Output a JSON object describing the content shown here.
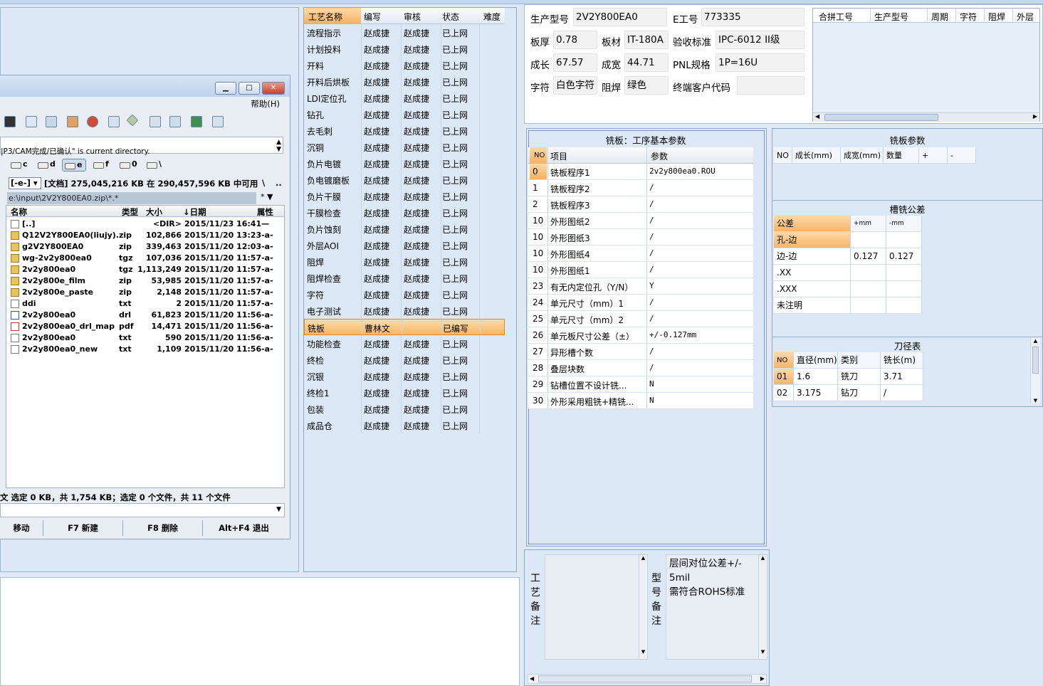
{
  "tc": {
    "menu_help": "帮助(H)",
    "current_dir_text": "|P3/CAM完成/已确认\" is current directory.",
    "drives": [
      "c",
      "d",
      "e",
      "f",
      "0",
      "\\"
    ],
    "drive_select": "[-e-]",
    "info": "[文档]  275,045,216 KB 在 290,457,596 KB 中可用",
    "path": "e:\\input\\2V2Y800EA0.zip\\*.*",
    "path_right": "* ▼",
    "columns": {
      "name": "名称",
      "type": "类型",
      "size": "大小",
      "date": "↓日期",
      "attr": "属性"
    },
    "files": [
      {
        "icon": "up-dir-icon",
        "name": "[..]",
        "type": "",
        "size": "<DIR>",
        "date": "2015/11/23 16:41—"
      },
      {
        "icon": "zip-file-icon",
        "name": "Q12V2Y800EA0(liujy)..",
        "type": "zip",
        "size": "102,866",
        "date": "2015/11/20 13:23-a-"
      },
      {
        "icon": "zip-file-icon",
        "name": "g2V2Y800EA0",
        "type": "zip",
        "size": "339,463",
        "date": "2015/11/20 12:03-a-"
      },
      {
        "icon": "zip-file-icon",
        "name": "wg-2v2y800ea0",
        "type": "tgz",
        "size": "107,036",
        "date": "2015/11/20 11:57-a-"
      },
      {
        "icon": "zip-file-icon",
        "name": "2v2y800ea0",
        "type": "tgz",
        "size": "1,113,249",
        "date": "2015/11/20 11:57-a-"
      },
      {
        "icon": "zip-file-icon",
        "name": "2v2y800e_film",
        "type": "zip",
        "size": "53,985",
        "date": "2015/11/20 11:57-a-"
      },
      {
        "icon": "zip-file-icon",
        "name": "2v2y800e_paste",
        "type": "zip",
        "size": "2,148",
        "date": "2015/11/20 11:57-a-"
      },
      {
        "icon": "text-file-icon",
        "name": "ddi",
        "type": "txt",
        "size": "2",
        "date": "2015/11/20 11:57-a-"
      },
      {
        "icon": "drill-file-icon",
        "name": "2v2y800ea0",
        "type": "drl",
        "size": "61,823",
        "date": "2015/11/20 11:56-a-"
      },
      {
        "icon": "pdf-file-icon",
        "name": "2v2y800ea0_drl_map",
        "type": "pdf",
        "size": "14,471",
        "date": "2015/11/20 11:56-a-"
      },
      {
        "icon": "text-file-icon",
        "name": "2v2y800ea0",
        "type": "txt",
        "size": "590",
        "date": "2015/11/20 11:56-a-"
      },
      {
        "icon": "text-file-icon",
        "name": "2v2y800ea0_new",
        "type": "txt",
        "size": "1,109",
        "date": "2015/11/20 11:56-a-"
      }
    ],
    "status": "文  选定 0 KB，共 1,754 KB；选定 0 个文件，共 11 个文件",
    "fkeys": [
      "移动",
      "F7 新建",
      "F8 删除",
      "Alt+F4 退出"
    ]
  },
  "process": {
    "headers": [
      "工艺名称",
      "编写",
      "审核",
      "状态",
      "难度"
    ],
    "rows": [
      [
        "流程指示",
        "赵成捷",
        "赵成捷",
        "已上网"
      ],
      [
        "计划投料",
        "赵成捷",
        "赵成捷",
        "已上网"
      ],
      [
        "开料",
        "赵成捷",
        "赵成捷",
        "已上网"
      ],
      [
        "开料后烘板",
        "赵成捷",
        "赵成捷",
        "已上网"
      ],
      [
        "LDI定位孔",
        "赵成捷",
        "赵成捷",
        "已上网"
      ],
      [
        "钻孔",
        "赵成捷",
        "赵成捷",
        "已上网"
      ],
      [
        "去毛刺",
        "赵成捷",
        "赵成捷",
        "已上网"
      ],
      [
        "沉铜",
        "赵成捷",
        "赵成捷",
        "已上网"
      ],
      [
        "负片电镀",
        "赵成捷",
        "赵成捷",
        "已上网"
      ],
      [
        "负电镀磨板",
        "赵成捷",
        "赵成捷",
        "已上网"
      ],
      [
        "负片干膜",
        "赵成捷",
        "赵成捷",
        "已上网"
      ],
      [
        "干膜检查",
        "赵成捷",
        "赵成捷",
        "已上网"
      ],
      [
        "负片蚀刻",
        "赵成捷",
        "赵成捷",
        "已上网"
      ],
      [
        "外层AOI",
        "赵成捷",
        "赵成捷",
        "已上网"
      ],
      [
        "阻焊",
        "赵成捷",
        "赵成捷",
        "已上网"
      ],
      [
        "阻焊检查",
        "赵成捷",
        "赵成捷",
        "已上网"
      ],
      [
        "字符",
        "赵成捷",
        "赵成捷",
        "已上网"
      ],
      [
        "电子测试",
        "赵成捷",
        "赵成捷",
        "已上网"
      ],
      [
        "铣板",
        "曹林文",
        "",
        "已编写"
      ],
      [
        "功能检查",
        "赵成捷",
        "赵成捷",
        "已上网"
      ],
      [
        "终检",
        "赵成捷",
        "赵成捷",
        "已上网"
      ],
      [
        "沉银",
        "赵成捷",
        "赵成捷",
        "已上网"
      ],
      [
        "终检1",
        "赵成捷",
        "赵成捷",
        "已上网"
      ],
      [
        "包装",
        "赵成捷",
        "赵成捷",
        "已上网"
      ],
      [
        "成品仓",
        "赵成捷",
        "赵成捷",
        "已上网"
      ]
    ]
  },
  "info": {
    "model_label": "生产型号",
    "model": "2V2Y800EA0",
    "eno_label": "E工号",
    "eno": "773335",
    "thick_label": "板厚",
    "thick": "0.78",
    "mat_label": "板材",
    "mat": "IT-180A",
    "std_label": "验收标准",
    "std": "IPC-6012 II级",
    "len_label": "成长",
    "len": "67.57",
    "wid_label": "成宽",
    "wid": "44.71",
    "pnl_label": "PNL规格",
    "pnl": "1P=16U",
    "char_label": "字符",
    "char": "白色字符",
    "mask_label": "阻焊",
    "mask": "绿色",
    "cust_label": "终端客户代码",
    "cust": "",
    "combo_headers": [
      "合拼工号",
      "生产型号",
      "周期",
      "字符",
      "阻焊",
      "外层"
    ]
  },
  "mill": {
    "title": "铣板：工序基本参数",
    "headers": [
      "NO",
      "项目",
      "参数"
    ],
    "rows": [
      [
        "0",
        "铣板程序1",
        "2v2y800ea0.ROU"
      ],
      [
        "1",
        "铣板程序2",
        "/"
      ],
      [
        "2",
        "铣板程序3",
        "/"
      ],
      [
        "10",
        "外形图纸2",
        "/"
      ],
      [
        "10",
        "外形图纸3",
        "/"
      ],
      [
        "10",
        "外形图纸4",
        "/"
      ],
      [
        "10",
        "外形图纸1",
        "/"
      ],
      [
        "23",
        "有无内定位孔（Y/N）",
        "Y"
      ],
      [
        "24",
        "单元尺寸（mm）1",
        "/"
      ],
      [
        "25",
        "单元尺寸（mm）2",
        "/"
      ],
      [
        "26",
        "单元板尺寸公差（±）",
        "+/-0.127mm"
      ],
      [
        "27",
        "异形槽个数",
        "/"
      ],
      [
        "28",
        "叠层块数",
        "/"
      ],
      [
        "29",
        "钻槽位置不设计铣...",
        "N"
      ],
      [
        "30",
        "外形采用粗铣+精铣...",
        "N"
      ]
    ]
  },
  "notes": {
    "craft_label": "工艺备注",
    "craft_text": "",
    "model_label": "型号备注",
    "model_text_1": "层间对位公差+/-",
    "model_text_2": "5mil",
    "model_text_3": "需符合ROHS标准"
  },
  "rparams": {
    "title": "铣板参数",
    "headers": [
      "NO",
      "成长(mm)",
      "成宽(mm)",
      "数量",
      "+",
      "-"
    ],
    "tol_title": "槽铣公差",
    "tol_headers": [
      "公差",
      "+mm",
      "-mm"
    ],
    "tol_rows": [
      [
        "孔-边",
        "",
        ""
      ],
      [
        "边-边",
        "0.127",
        "0.127"
      ],
      [
        ".XX",
        "",
        ""
      ],
      [
        ".XXX",
        "",
        ""
      ],
      [
        "未注明",
        "",
        ""
      ]
    ],
    "tool_title": "刀径表",
    "tool_headers": [
      "NO",
      "直径(mm)",
      "类别",
      "铣长(m)"
    ],
    "tool_rows": [
      [
        "01",
        "1.6",
        "铣刀",
        "3.71"
      ],
      [
        "02",
        "3.175",
        "钻刀",
        "/"
      ]
    ]
  }
}
